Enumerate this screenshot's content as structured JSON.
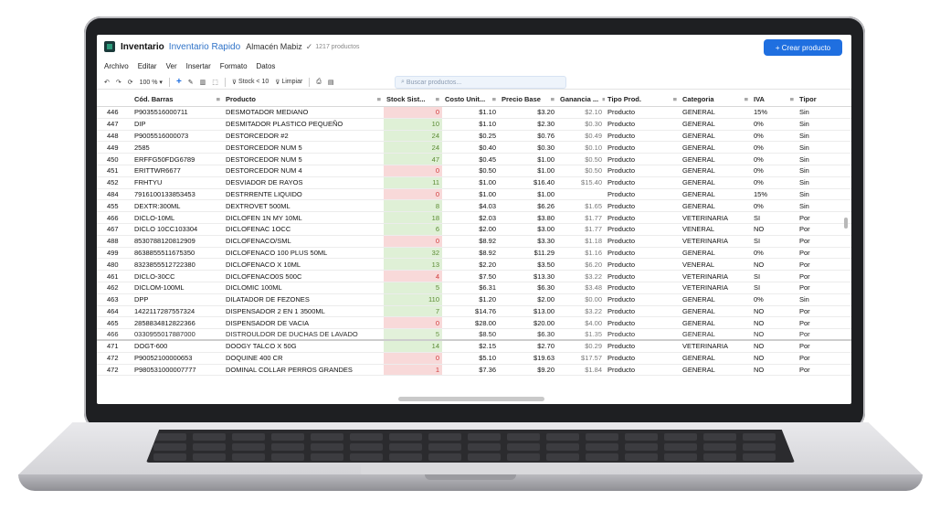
{
  "titlebar": {
    "title": "Inventario",
    "subtitle": "Inventario Rapido",
    "store": "Almacén Mabiz",
    "check": "✓",
    "count": "1217 productos",
    "create_button": "+ Crear producto"
  },
  "menu": [
    "Archivo",
    "Editar",
    "Ver",
    "Insertar",
    "Formato",
    "Datos"
  ],
  "toolbar": {
    "zoom": "100 % ▾",
    "stock_filter": "Stock < 10",
    "clear": "Limpiar",
    "search_placeholder": "Buscar productos..."
  },
  "table": {
    "headers": [
      "",
      "Cód. Barras",
      "Producto",
      "Stock Sist...",
      "Costo Unit...",
      "Precio Base",
      "Ganancia ...",
      "Tipo Prod.",
      "Categoria",
      "IVA",
      "Tipor"
    ],
    "rows": [
      {
        "n": "446",
        "cod": "P9035516000711",
        "prod": "DESMOTADOR MEDIANO",
        "stock": "0",
        "cost": "$1.10",
        "price": "$3.20",
        "gan": "$2.10",
        "tipo": "Producto",
        "cat": "GENERAL",
        "iva": "15%",
        "tr": "Sin",
        "s": "red"
      },
      {
        "n": "447",
        "cod": "DIP",
        "prod": "DESMITADOR PLASTICO PEQUEÑO",
        "stock": "10",
        "cost": "$1.10",
        "price": "$2.30",
        "gan": "$0.30",
        "tipo": "Producto",
        "cat": "GENERAL",
        "iva": "0%",
        "tr": "Sin",
        "s": "green"
      },
      {
        "n": "448",
        "cod": "P9005516000073",
        "prod": "DESTORCEDOR #2",
        "stock": "24",
        "cost": "$0.25",
        "price": "$0.76",
        "gan": "$0.49",
        "tipo": "Producto",
        "cat": "GENERAL",
        "iva": "0%",
        "tr": "Sin",
        "s": "green"
      },
      {
        "n": "449",
        "cod": "2585",
        "prod": "DESTORCEDOR NUM 5",
        "stock": "24",
        "cost": "$0.40",
        "price": "$0.30",
        "gan": "$0.10",
        "tipo": "Producto",
        "cat": "GENERAL",
        "iva": "0%",
        "tr": "Sin",
        "s": "green"
      },
      {
        "n": "450",
        "cod": "ERFFG50FDG6789",
        "prod": "DESTORCEDOR NUM 5",
        "stock": "47",
        "cost": "$0.45",
        "price": "$1.00",
        "gan": "$0.50",
        "tipo": "Producto",
        "cat": "GENERAL",
        "iva": "0%",
        "tr": "Sin",
        "s": "green"
      },
      {
        "n": "451",
        "cod": "ERITTWR6677",
        "prod": "DESTORCEDOR NUM 4",
        "stock": "0",
        "cost": "$0.50",
        "price": "$1.00",
        "gan": "$0.50",
        "tipo": "Producto",
        "cat": "GENERAL",
        "iva": "0%",
        "tr": "Sin",
        "s": "red"
      },
      {
        "n": "452",
        "cod": "FRHTYU",
        "prod": "DESVIADOR DE RAYOS",
        "stock": "11",
        "cost": "$1.00",
        "price": "$16.40",
        "gan": "$15.40",
        "tipo": "Producto",
        "cat": "GENERAL",
        "iva": "0%",
        "tr": "Sin",
        "s": "green"
      },
      {
        "n": "484",
        "cod": "7916100133853453",
        "prod": "DESTRRENTE LIQUIDO",
        "stock": "0",
        "cost": "$1.00",
        "price": "$1.00",
        "gan": "",
        "tipo": "Producto",
        "cat": "GENERAL",
        "iva": "15%",
        "tr": "Sin",
        "s": "red"
      },
      {
        "n": "455",
        "cod": "DEXTR:300ML",
        "prod": "DEXTROVET 500ML",
        "stock": "8",
        "cost": "$4.03",
        "price": "$6.26",
        "gan": "$1.65",
        "tipo": "Producto",
        "cat": "GENERAL",
        "iva": "0%",
        "tr": "Sin",
        "s": "green"
      },
      {
        "n": "466",
        "cod": "DICLO-10ML",
        "prod": "DICLOFEN 1N MY 10ML",
        "stock": "18",
        "cost": "$2.03",
        "price": "$3.80",
        "gan": "$1.77",
        "tipo": "Producto",
        "cat": "VETERINARIA",
        "iva": "SI",
        "tr": "Por",
        "s": "green"
      },
      {
        "n": "467",
        "cod": "DICLO 10CC103304",
        "prod": "DICLOFENAC 1OCC",
        "stock": "6",
        "cost": "$2.00",
        "price": "$3.00",
        "gan": "$1.77",
        "tipo": "Producto",
        "cat": "VENERAL",
        "iva": "NO",
        "tr": "Por",
        "s": "green"
      },
      {
        "n": "488",
        "cod": "8530788120812909",
        "prod": "DICLOFENACO/SML",
        "stock": "0",
        "cost": "$8.92",
        "price": "$3.30",
        "gan": "$1.18",
        "tipo": "Producto",
        "cat": "VETERINARIA",
        "iva": "SI",
        "tr": "Por",
        "s": "red"
      },
      {
        "n": "499",
        "cod": "8638855511675350",
        "prod": "DICLOFENACO 100 PLUS 50ML",
        "stock": "32",
        "cost": "$8.92",
        "price": "$11.29",
        "gan": "$1.16",
        "tipo": "Producto",
        "cat": "GENERAL",
        "iva": "0%",
        "tr": "Por",
        "s": "green"
      },
      {
        "n": "480",
        "cod": "8323855512722380",
        "prod": "DICLOFENACO X 10ML",
        "stock": "13",
        "cost": "$2.20",
        "price": "$3.50",
        "gan": "$6.20",
        "tipo": "Producto",
        "cat": "VENERAL",
        "iva": "NO",
        "tr": "Por",
        "s": "green"
      },
      {
        "n": "461",
        "cod": "DICLO-30CC",
        "prod": "DICLOFENACO0S 500C",
        "stock": "4",
        "cost": "$7.50",
        "price": "$13.30",
        "gan": "$3.22",
        "tipo": "Producto",
        "cat": "VETERINARIA",
        "iva": "SI",
        "tr": "Por",
        "s": "red"
      },
      {
        "n": "462",
        "cod": "DICLOM-100ML",
        "prod": "DICLOMIC 100ML",
        "stock": "5",
        "cost": "$6.31",
        "price": "$6.30",
        "gan": "$3.48",
        "tipo": "Producto",
        "cat": "VETERINARIA",
        "iva": "SI",
        "tr": "Por",
        "s": "green"
      },
      {
        "n": "463",
        "cod": "DPP",
        "prod": "DILATADOR DE FEZONES",
        "stock": "110",
        "cost": "$1.20",
        "price": "$2.00",
        "gan": "$0.00",
        "tipo": "Producto",
        "cat": "GENERAL",
        "iva": "0%",
        "tr": "Sin",
        "s": "green"
      },
      {
        "n": "464",
        "cod": "1422117287557324",
        "prod": "DISPENSADOR 2 EN 1 3500ML",
        "stock": "7",
        "cost": "$14.76",
        "price": "$13.00",
        "gan": "$3.22",
        "tipo": "Producto",
        "cat": "GENERAL",
        "iva": "NO",
        "tr": "Por",
        "s": "green"
      },
      {
        "n": "465",
        "cod": "2858834812822366",
        "prod": "DISPENSADOR DE VACIA",
        "stock": "0",
        "cost": "$28.00",
        "price": "$20.00",
        "gan": "$4.00",
        "tipo": "Producto",
        "cat": "GENERAL",
        "iva": "NO",
        "tr": "Por",
        "s": "red"
      },
      {
        "n": "466",
        "cod": "0330955017887000",
        "prod": "DISTROULDOR DE DUCHAS DE LAVADO",
        "stock": "5",
        "cost": "$8.50",
        "price": "$6.30",
        "gan": "$1.35",
        "tipo": "Producto",
        "cat": "GENERAL",
        "iva": "NO",
        "tr": "Por",
        "s": "green"
      },
      {
        "n": "471",
        "cod": "DOGT-600",
        "prod": "DOOGY TALCO X 50G",
        "stock": "14",
        "cost": "$2.15",
        "price": "$2.70",
        "gan": "$0.29",
        "tipo": "Producto",
        "cat": "VETERINARIA",
        "iva": "NO",
        "tr": "Por",
        "s": "green"
      },
      {
        "n": "472",
        "cod": "P90052100000653",
        "prod": "DOQUINE 400 CR",
        "stock": "0",
        "cost": "$5.10",
        "price": "$19.63",
        "gan": "$17.57",
        "tipo": "Producto",
        "cat": "GENERAL",
        "iva": "NO",
        "tr": "Por",
        "s": "red"
      },
      {
        "n": "472",
        "cod": "P980531000007777",
        "prod": "DOMINAL COLLAR PERROS GRANDES",
        "stock": "1",
        "cost": "$7.36",
        "price": "$9.20",
        "gan": "$1.84",
        "tipo": "Producto",
        "cat": "GENERAL",
        "iva": "NO",
        "tr": "Por",
        "s": "red"
      }
    ]
  }
}
